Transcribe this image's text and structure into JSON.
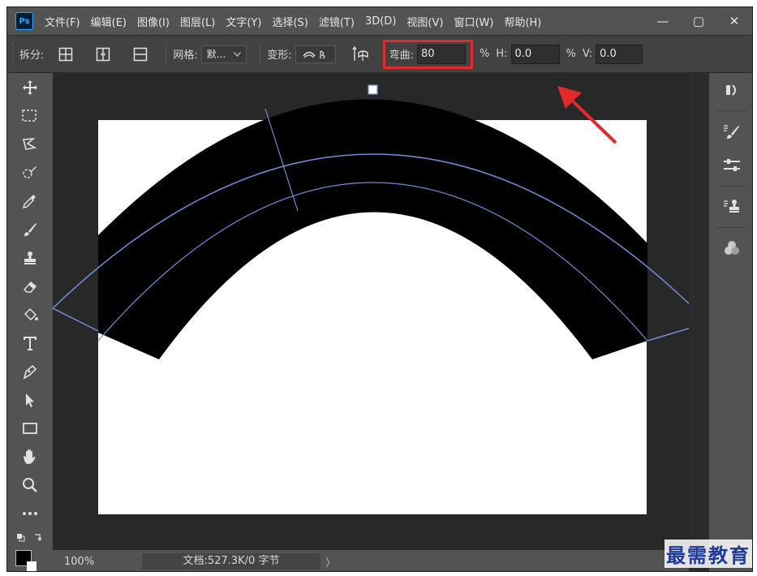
{
  "app": {
    "logo": "Ps"
  },
  "menu": [
    "文件(F)",
    "编辑(E)",
    "图像(I)",
    "图层(L)",
    "文字(Y)",
    "选择(S)",
    "滤镜(T)",
    "3D(D)",
    "视图(V)",
    "窗口(W)",
    "帮助(H)"
  ],
  "window_controls": {
    "minimize": "—",
    "restore": "▢",
    "close": "✕"
  },
  "options": {
    "split_label": "拆分:",
    "grid_label": "网格:",
    "grid_value": "默...",
    "warp_label": "变形:",
    "bend_label": "弯曲:",
    "bend_value": "80",
    "bend_unit": "%",
    "h_label": "H:",
    "h_value": "0.0",
    "h_unit": "%",
    "v_label": "V:",
    "v_value": "0.0"
  },
  "status": {
    "zoom": "100%",
    "doc": "文档:527.3K/0 字节",
    "arrow": "〉"
  },
  "watermark": "最需教育",
  "colors": {
    "highlight": "#e2292c",
    "warp_mesh": "#6d8fd8",
    "foreground": "#000000",
    "background": "#ffffff"
  }
}
